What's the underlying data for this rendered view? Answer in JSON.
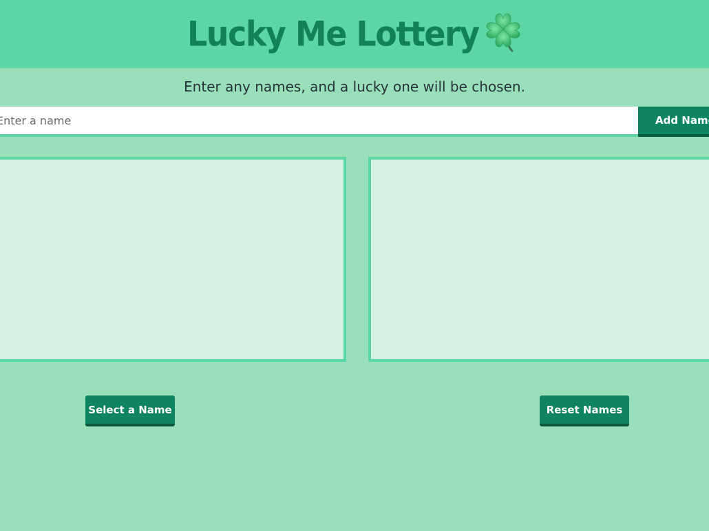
{
  "header": {
    "title": "Lucky Me Lottery",
    "icon": "four-leaf-clover-icon",
    "background": "#5bd6a4",
    "title_color": "#118257"
  },
  "subtitle": "Enter any names, and a lucky one will be chosen.",
  "name_entry": {
    "placeholder": "Enter a name",
    "value": "",
    "add_label": "Add Name"
  },
  "panels": {
    "names_list": [],
    "chosen_name": ""
  },
  "actions": {
    "select_label": "Select a Name",
    "reset_label": "Reset Names"
  },
  "colors": {
    "page_background": "#99dfb9",
    "panel_background": "#d6f2e3",
    "panel_border": "#5bd6a4",
    "button": "#0f8460",
    "button_shadow": "#0a5a3f"
  }
}
